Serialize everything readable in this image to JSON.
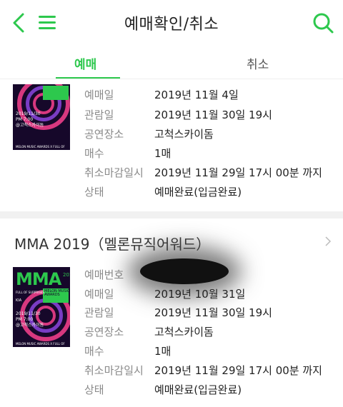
{
  "header": {
    "title": "예매확인/취소",
    "accent_color": "#2dc84d",
    "icons": [
      "back-arrow-icon",
      "menu-icon",
      "search-icon"
    ]
  },
  "tabs": [
    {
      "label": "예매",
      "active": true
    },
    {
      "label": "취소",
      "active": false
    }
  ],
  "booking1": {
    "rows": [
      {
        "label": "예매일",
        "value": "2019년 11월 4일"
      },
      {
        "label": "관람일",
        "value": "2019년 11월 30일 19시"
      },
      {
        "label": "공연장소",
        "value": "고척스카이돔"
      },
      {
        "label": "매수",
        "value": "1매"
      },
      {
        "label": "취소마감일시",
        "value": "2019년 11월 29일 17시 00분 까지"
      },
      {
        "label": "상태",
        "value": "예매완료(입금완료)"
      }
    ]
  },
  "booking2": {
    "title": "MMA 2019（멜론뮤직어워드）",
    "rows": [
      {
        "label": "예매번호",
        "value": ""
      },
      {
        "label": "예매일",
        "value": "2019년 10월 31일"
      },
      {
        "label": "관람일",
        "value": "2019년 11월 30일 19시"
      },
      {
        "label": "공연장소",
        "value": "고척스카이돔"
      },
      {
        "label": "매수",
        "value": "1매"
      },
      {
        "label": "취소마감일시",
        "value": "2019년 11월 29일 17시 00분 까지"
      },
      {
        "label": "상태",
        "value": "예매완료(입금완료)"
      }
    ]
  },
  "poster": {
    "logo": "MMA",
    "side_text": "2019",
    "small_text": "FULL OF SURPRISES",
    "brand": "MELON MUSIC AWARDS",
    "sponsor": "KIA",
    "date_text": "2019/11/30",
    "time_text": "PM 7:00",
    "venue_text": "@고척스카이돔",
    "footer_text": "MELON MUSIC AWARDS X FULL OF SURPRISES"
  }
}
